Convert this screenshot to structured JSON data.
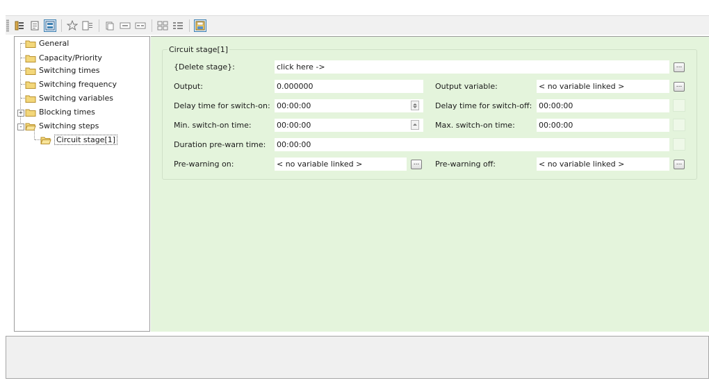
{
  "toolbar": {
    "buttons": [
      {
        "icon": "tree-view-icon"
      },
      {
        "icon": "page-view-icon"
      },
      {
        "icon": "form-view-icon",
        "active": true
      },
      {
        "icon": "favorites-star-icon"
      },
      {
        "icon": "list-details-icon"
      },
      {
        "icon": "copy-page-icon"
      },
      {
        "icon": "field-width-icon"
      },
      {
        "icon": "field-text-icon"
      },
      {
        "icon": "grid-layout-icon"
      },
      {
        "icon": "list-layout-icon"
      },
      {
        "icon": "save-settings-icon",
        "active": true
      }
    ]
  },
  "tree": {
    "items": [
      {
        "label": "General"
      },
      {
        "label": "Capacity/Priority"
      },
      {
        "label": "Switching times"
      },
      {
        "label": "Switching frequency"
      },
      {
        "label": "Switching variables"
      },
      {
        "label": "Blocking times",
        "expander": "+"
      },
      {
        "label": "Switching steps",
        "expander": "-"
      },
      {
        "label": "Circuit stage[1]",
        "selected": true
      }
    ]
  },
  "stage": {
    "title": "Circuit stage[1]",
    "delete_label": "{Delete stage}:",
    "delete_value": "click here ->",
    "output_label": "Output:",
    "output_value": "0.000000",
    "output_var_label": "Output variable:",
    "output_var_value": "< no variable linked >",
    "delay_on_label": "Delay time for switch-on:",
    "delay_on_value": "00:00:00",
    "delay_off_label": "Delay time for switch-off:",
    "delay_off_value": "00:00:00",
    "min_on_label": "Min. switch-on time:",
    "min_on_value": "00:00:00",
    "max_on_label": "Max. switch-on time:",
    "max_on_value": "00:00:00",
    "prewarn_label": "Duration pre-warn time:",
    "prewarn_value": "00:00:00",
    "prewarn_on_label": "Pre-warning on:",
    "prewarn_on_value": "< no variable linked >",
    "prewarn_off_label": "Pre-warning off:",
    "prewarn_off_value": "< no variable linked >",
    "ellipsis": "..."
  },
  "colors": {
    "content_bg": "#e4f4dc",
    "folder": "#e8c25a",
    "toolbar_accent": "#3c7fb1"
  }
}
